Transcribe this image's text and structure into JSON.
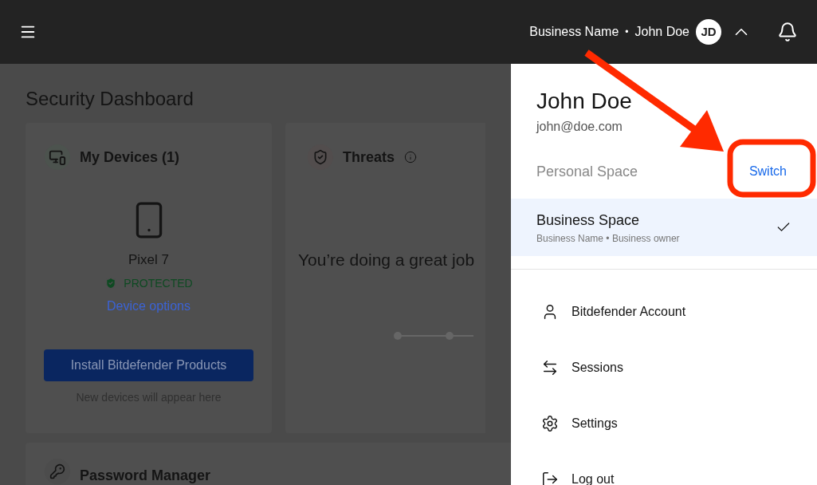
{
  "header": {
    "business_name": "Business Name",
    "separator": "•",
    "user_name": "John Doe",
    "avatar_initials": "JD",
    "menu_expanded": true
  },
  "dashboard": {
    "title": "Security Dashboard",
    "devices_card": {
      "title": "My Devices (1)",
      "device_name": "Pixel 7",
      "status": "PROTECTED",
      "options_link": "Device options",
      "install_button": "Install Bitdefender Products",
      "hint": "New devices will appear here"
    },
    "threats_card": {
      "title": "Threats",
      "message": "You’re doing a great job"
    },
    "password_card": {
      "title": "Password Manager"
    }
  },
  "account_menu": {
    "name": "John Doe",
    "email": "john@doe.com",
    "spaces": [
      {
        "name": "Personal Space",
        "action": "Switch",
        "selected": false
      },
      {
        "name": "Business Space",
        "subtitle": "Business Name • Business owner",
        "selected": true
      }
    ],
    "items": [
      {
        "kind": "account",
        "label": "Bitdefender Account"
      },
      {
        "kind": "sessions",
        "label": "Sessions"
      },
      {
        "kind": "settings",
        "label": "Settings"
      },
      {
        "kind": "logout",
        "label": "Log out"
      }
    ]
  }
}
